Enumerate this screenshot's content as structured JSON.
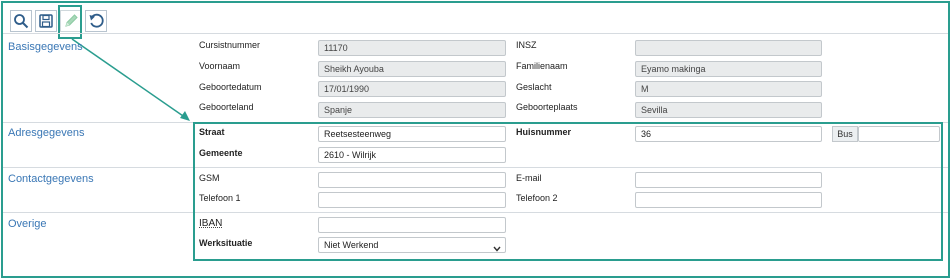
{
  "toolbar": {
    "buttons": [
      {
        "icon": "search-icon"
      },
      {
        "icon": "save-icon"
      },
      {
        "icon": "edit-pencil-icon"
      },
      {
        "icon": "undo-icon"
      }
    ]
  },
  "colors": {
    "accent": "#2a9d8f",
    "section_label": "#3a77b5",
    "readonly_bg": "#e9ebec"
  },
  "sections": {
    "basis": {
      "title": "Basisgegevens",
      "cursistnummer": {
        "label": "Cursistnummer",
        "value": "11170"
      },
      "insz": {
        "label": "INSZ",
        "value": ""
      },
      "voornaam": {
        "label": "Voornaam",
        "value": "Sheikh Ayouba"
      },
      "familienaam": {
        "label": "Familienaam",
        "value": "Eyamo makinga"
      },
      "geboortedatum": {
        "label": "Geboortedatum",
        "value": "17/01/1990"
      },
      "geslacht": {
        "label": "Geslacht",
        "value": "M"
      },
      "geboorteland": {
        "label": "Geboorteland",
        "value": "Spanje"
      },
      "geboorteplaats": {
        "label": "Geboorteplaats",
        "value": "Sevilla"
      }
    },
    "adres": {
      "title": "Adresgegevens",
      "straat": {
        "label": "Straat",
        "value": "Reetsesteenweg"
      },
      "huisnummer": {
        "label": "Huisnummer",
        "value": "36"
      },
      "bus": {
        "label": "Bus",
        "value": ""
      },
      "gemeente": {
        "label": "Gemeente",
        "value": "2610 - Wilrijk"
      }
    },
    "contact": {
      "title": "Contactgegevens",
      "gsm": {
        "label": "GSM",
        "value": ""
      },
      "email": {
        "label": "E-mail",
        "value": ""
      },
      "telefoon1": {
        "label": "Telefoon 1",
        "value": ""
      },
      "telefoon2": {
        "label": "Telefoon 2",
        "value": ""
      }
    },
    "overige": {
      "title": "Overige",
      "iban": {
        "label": "IBAN",
        "value": ""
      },
      "werksituatie": {
        "label": "Werksituatie",
        "value": "Niet Werkend"
      }
    }
  }
}
